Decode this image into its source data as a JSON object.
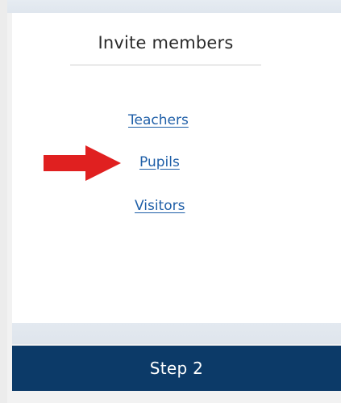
{
  "panel": {
    "title": "Invite members",
    "links": {
      "teachers": "Teachers",
      "pupils": "Pupils",
      "visitors": "Visitors"
    },
    "colors": {
      "link": "#1f5fa8",
      "arrow": "#e02020",
      "step_bar": "#0c3a68"
    }
  },
  "annotation": {
    "arrow_icon": "red-right-arrow-icon"
  },
  "footer": {
    "step_label": "Step 2"
  }
}
